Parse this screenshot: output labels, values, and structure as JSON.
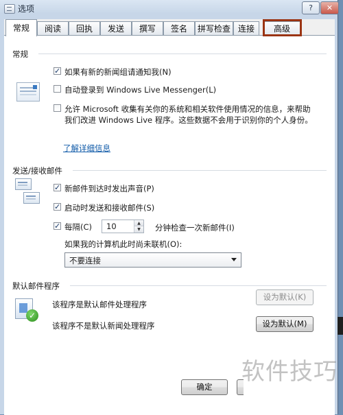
{
  "window": {
    "title": "选项",
    "help_label": "?",
    "close_label": "✕"
  },
  "tabs": [
    {
      "label": "常规"
    },
    {
      "label": "阅读"
    },
    {
      "label": "回执"
    },
    {
      "label": "发送"
    },
    {
      "label": "撰写"
    },
    {
      "label": "签名"
    },
    {
      "label": "拼写检查"
    },
    {
      "label": "连接"
    },
    {
      "label": "高级"
    }
  ],
  "general": {
    "title": "常规",
    "options": [
      {
        "label": "如果有新的新闻组请通知我(N)",
        "checked": true
      },
      {
        "label": "自动登录到 Windows Live Messenger(L)",
        "checked": false
      },
      {
        "label": "允许 Microsoft 收集有关你的系统和相关软件使用情况的信息，来帮助我们改进 Windows Live 程序。这些数据不会用于识别你的个人身份。",
        "checked": false
      }
    ],
    "learn_more_link": "了解详细信息"
  },
  "send_receive": {
    "title": "发送/接收邮件",
    "options": [
      {
        "label": "新邮件到达时发出声音(P)",
        "checked": true
      },
      {
        "label": "启动时发送和接收邮件(S)",
        "checked": true
      },
      {
        "label": "每隔(C)",
        "checked": true
      }
    ],
    "interval_value": "10",
    "interval_suffix": "分钟检查一次新邮件(I)",
    "offline_label": "如果我的计算机此时尚未联机(O):",
    "offline_select": "不要连接"
  },
  "default_program": {
    "title": "默认邮件程序",
    "mail_status": "该程序是默认邮件处理程序",
    "news_status": "该程序不是默认新闻处理程序",
    "set_default_mail": "设为默认(K)",
    "set_default_news": "设为默认(M)"
  },
  "footer": {
    "ok_label": "确定"
  },
  "watermark": "软件技巧",
  "colors": {
    "highlight_box": "#9b3412",
    "link": "#0f5aa8"
  }
}
